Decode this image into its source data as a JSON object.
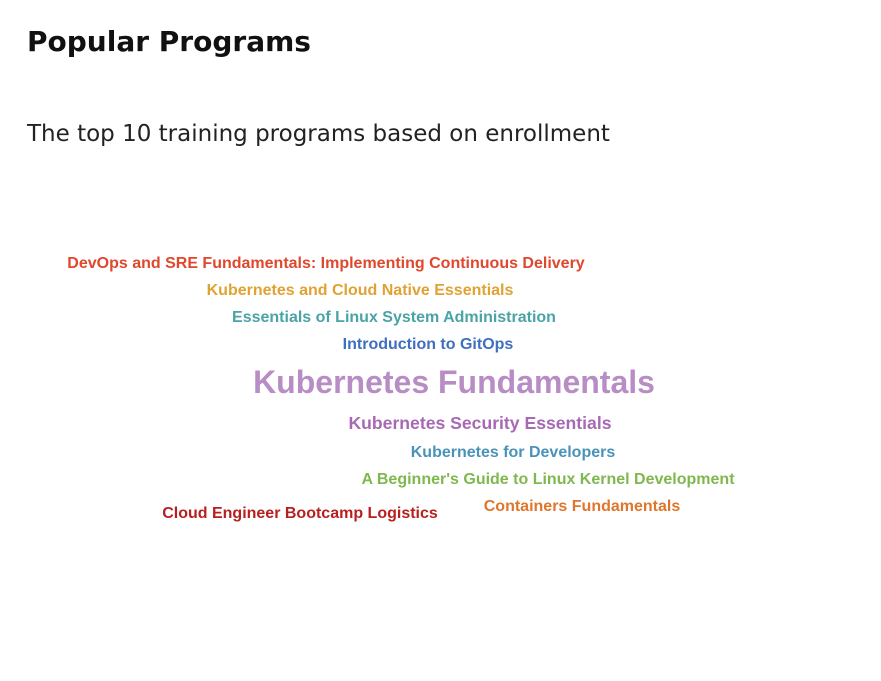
{
  "header": {
    "title": "Popular Programs",
    "subtitle": "The top 10 training programs based on enrollment"
  },
  "chart_data": {
    "type": "word-cloud",
    "title": "Popular Programs",
    "subtitle": "The top 10 training programs based on enrollment",
    "words": [
      {
        "text": "Kubernetes Fundamentals",
        "weight": 10,
        "color": "#b88cc4"
      },
      {
        "text": "DevOps and SRE Fundamentals: Implementing Continuous Delivery",
        "weight": 5,
        "color": "#e0472d"
      },
      {
        "text": "Kubernetes and Cloud Native Essentials",
        "weight": 5,
        "color": "#e0a232"
      },
      {
        "text": "Essentials of Linux System Administration",
        "weight": 5,
        "color": "#4aa3a6"
      },
      {
        "text": "Introduction to GitOps",
        "weight": 5,
        "color": "#3f6fbf"
      },
      {
        "text": "Kubernetes Security Essentials",
        "weight": 5.5,
        "color": "#a769b3"
      },
      {
        "text": "Kubernetes for Developers",
        "weight": 5,
        "color": "#4a93b8"
      },
      {
        "text": "A Beginner's Guide to Linux Kernel Development",
        "weight": 5,
        "color": "#7fb84e"
      },
      {
        "text": "Cloud Engineer Bootcamp Logistics",
        "weight": 5,
        "color": "#b82020"
      },
      {
        "text": "Containers Fundamentals",
        "weight": 5,
        "color": "#e0762d"
      }
    ]
  }
}
